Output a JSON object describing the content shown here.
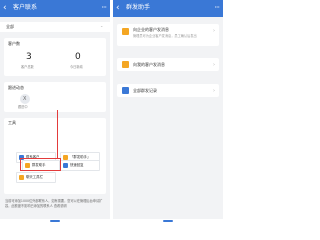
{
  "colors": {
    "primary": "#3a78d6",
    "highlight": "#e33b3b",
    "background": "#f2f3f5"
  },
  "left": {
    "title": "客户联系",
    "scope_label": "全部",
    "stats": {
      "heading": "客户数",
      "items": [
        {
          "value": "3",
          "label": "客户总数"
        },
        {
          "value": "0",
          "label": "今日新增"
        }
      ]
    },
    "followup": {
      "heading": "跟进动态",
      "avatar_letter": "X",
      "avatar_caption": "跟进中"
    },
    "tools": {
      "heading": "工具",
      "items": [
        {
          "label": "联系客户",
          "icon": "contact-icon"
        },
        {
          "label": "「群发助手」",
          "icon": "broadcast-icon"
        },
        {
          "label": "群发助手",
          "icon": "group-message-icon"
        },
        {
          "label": "快速回复",
          "icon": "quick-reply-icon"
        },
        {
          "label": "聊天工具栏",
          "icon": "toolbar-icon"
        }
      ]
    },
    "notice": "当前可添加1000位外部联系人，如有需要，您可以在管理后台申请扩容，此额度不影响已添加的联系人 查看说明"
  },
  "right": {
    "title": "群发助手",
    "menu": [
      {
        "label": "向企业的客户发消息",
        "desc": "管理员可为企业客户发消息，员工确认后发出",
        "icon": "company-icon",
        "color": "#f4a623"
      },
      {
        "label": "向我的客户发消息",
        "icon": "my-customer-icon",
        "color": "#f4a623"
      },
      {
        "label": "全部群发记录",
        "icon": "record-icon",
        "color": "#3a78d6"
      }
    ]
  }
}
